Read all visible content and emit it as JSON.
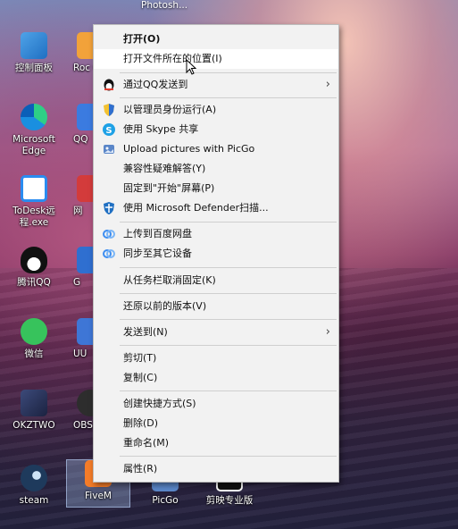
{
  "window_title_partial": "Photosh...",
  "desktop_icons": [
    {
      "label": "控制面板"
    },
    {
      "label": "Microsoft Edge"
    },
    {
      "label": "ToDesk远程.exe"
    },
    {
      "label": "腾讯QQ"
    },
    {
      "label": "微信"
    },
    {
      "label": "OKZTWO"
    },
    {
      "label": "steam"
    },
    {
      "label": "Roc Ga"
    },
    {
      "label": "QQ"
    },
    {
      "label": "网"
    },
    {
      "label": "G"
    },
    {
      "label": "UU"
    },
    {
      "label": "OBS"
    },
    {
      "label": "FiveM"
    },
    {
      "label": "PicGo"
    },
    {
      "label": "剪映专业版"
    }
  ],
  "context_menu": {
    "items": [
      {
        "label": "打开(O)",
        "bold": true
      },
      {
        "label": "打开文件所在的位置(I)"
      },
      {
        "label": "通过QQ发送到",
        "arrow": "›",
        "icon": "qq-icon"
      },
      {
        "label": "以管理员身份运行(A)",
        "icon": "uac-shield-icon"
      },
      {
        "label": "使用 Skype 共享",
        "icon": "skype-icon"
      },
      {
        "label": "Upload pictures with PicGo",
        "icon": "picgo-icon"
      },
      {
        "label": "兼容性疑难解答(Y)"
      },
      {
        "label": "固定到\"开始\"屏幕(P)"
      },
      {
        "label": "使用 Microsoft Defender扫描...",
        "icon": "defender-icon"
      },
      {
        "label": "上传到百度网盘",
        "icon": "baidu-netdisk-icon"
      },
      {
        "label": "同步至其它设备",
        "icon": "baidu-sync-icon"
      },
      {
        "label": "从任务栏取消固定(K)"
      },
      {
        "label": "还原以前的版本(V)"
      },
      {
        "label": "发送到(N)",
        "arrow": "›"
      },
      {
        "label": "剪切(T)"
      },
      {
        "label": "复制(C)"
      },
      {
        "label": "创建快捷方式(S)"
      },
      {
        "label": "删除(D)"
      },
      {
        "label": "重命名(M)"
      },
      {
        "label": "属性(R)"
      }
    ]
  }
}
